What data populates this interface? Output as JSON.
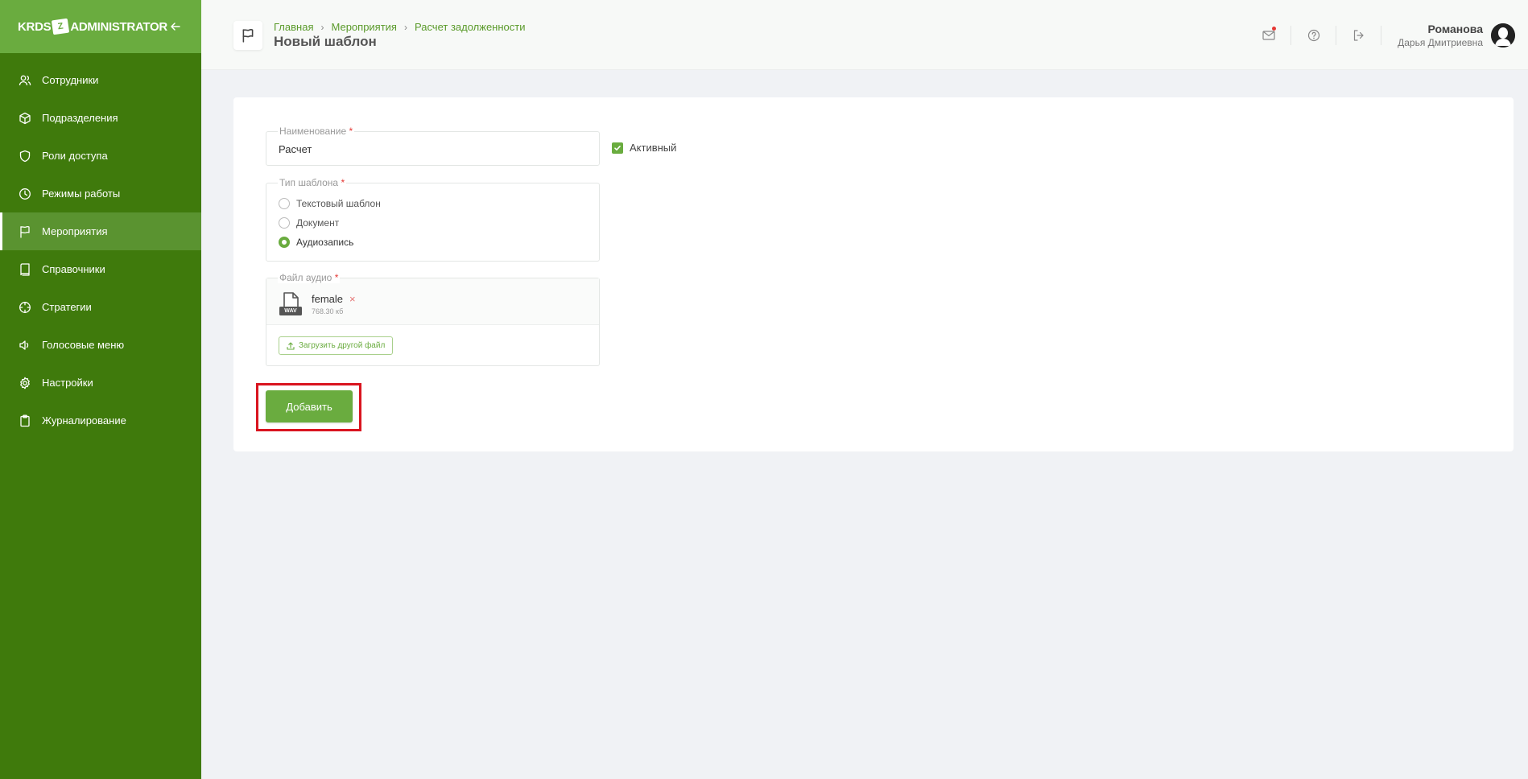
{
  "brand": {
    "left": "KRDS",
    "box": "Z",
    "right": "ADMINISTRATOR"
  },
  "sidebar": {
    "items": [
      {
        "label": "Сотрудники",
        "icon": "users-icon"
      },
      {
        "label": "Подразделения",
        "icon": "cube-icon"
      },
      {
        "label": "Роли доступа",
        "icon": "shield-icon"
      },
      {
        "label": "Режимы работы",
        "icon": "clock-icon"
      },
      {
        "label": "Мероприятия",
        "icon": "flag-icon",
        "active": true
      },
      {
        "label": "Справочники",
        "icon": "book-icon"
      },
      {
        "label": "Стратегии",
        "icon": "crosshair-icon"
      },
      {
        "label": "Голосовые меню",
        "icon": "speaker-icon"
      },
      {
        "label": "Настройки",
        "icon": "gear-icon"
      },
      {
        "label": "Журналирование",
        "icon": "clipboard-icon"
      }
    ]
  },
  "breadcrumb": {
    "home": "Главная",
    "events": "Мероприятия",
    "current": "Расчет задолженности"
  },
  "page": {
    "title": "Новый шаблон"
  },
  "user": {
    "last_name": "Романова",
    "first_name": "Дарья Дмитриевна"
  },
  "form": {
    "name_label": "Наименование",
    "required_mark": "*",
    "name_value": "Расчет",
    "active_label": "Активный",
    "type_label": "Тип шаблона",
    "types": [
      {
        "label": "Текстовый шаблон",
        "selected": false
      },
      {
        "label": "Документ",
        "selected": false
      },
      {
        "label": "Аудиозапись",
        "selected": true
      }
    ],
    "file_label": "Файл аудио",
    "file_name": "female",
    "file_ext": "WAV",
    "file_size": "768.30 кб",
    "file_remove": "×",
    "upload_label": "Загрузить другой файл",
    "submit_label": "Добавить"
  },
  "colors": {
    "sidebar": "#3f7a0c",
    "accent": "#6aac3f",
    "highlight": "#d9141f"
  }
}
